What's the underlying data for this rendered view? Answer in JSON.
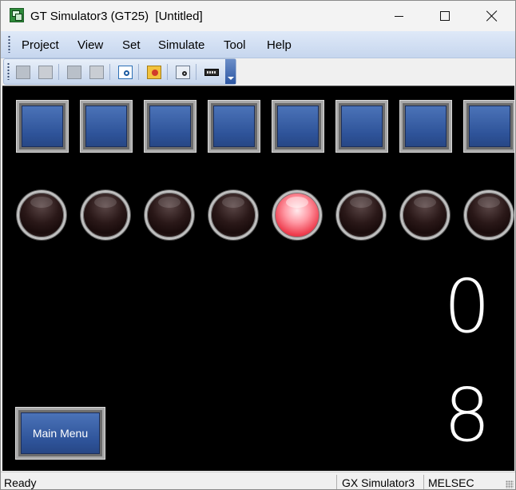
{
  "window": {
    "title": "GT Simulator3 (GT25)  [Untitled]"
  },
  "menu": {
    "items": [
      "Project",
      "View",
      "Set",
      "Simulate",
      "Tool",
      "Help"
    ]
  },
  "toolbar": {
    "icons": [
      "rotate-icon",
      "open-folder-icon",
      "device-icon",
      "device-alarm-icon",
      "zoom-screen-icon",
      "refresh-icon",
      "search-icon",
      "keyboard-icon"
    ]
  },
  "screen": {
    "square_buttons_count": 8,
    "lamps": [
      {
        "state": "off"
      },
      {
        "state": "off"
      },
      {
        "state": "off"
      },
      {
        "state": "off"
      },
      {
        "state": "on"
      },
      {
        "state": "off"
      },
      {
        "state": "off"
      },
      {
        "state": "off"
      }
    ],
    "numeric_display_1": "0",
    "numeric_display_2": "8",
    "main_menu_label": "Main Menu"
  },
  "status": {
    "left": "Ready",
    "simulator": "GX Simulator3",
    "plc": "MELSEC"
  },
  "colors": {
    "screen_bg": "#000000",
    "button_blue": "#2e5399",
    "lamp_on": "#ee3b4c",
    "menubar": "#c6d6ee"
  }
}
